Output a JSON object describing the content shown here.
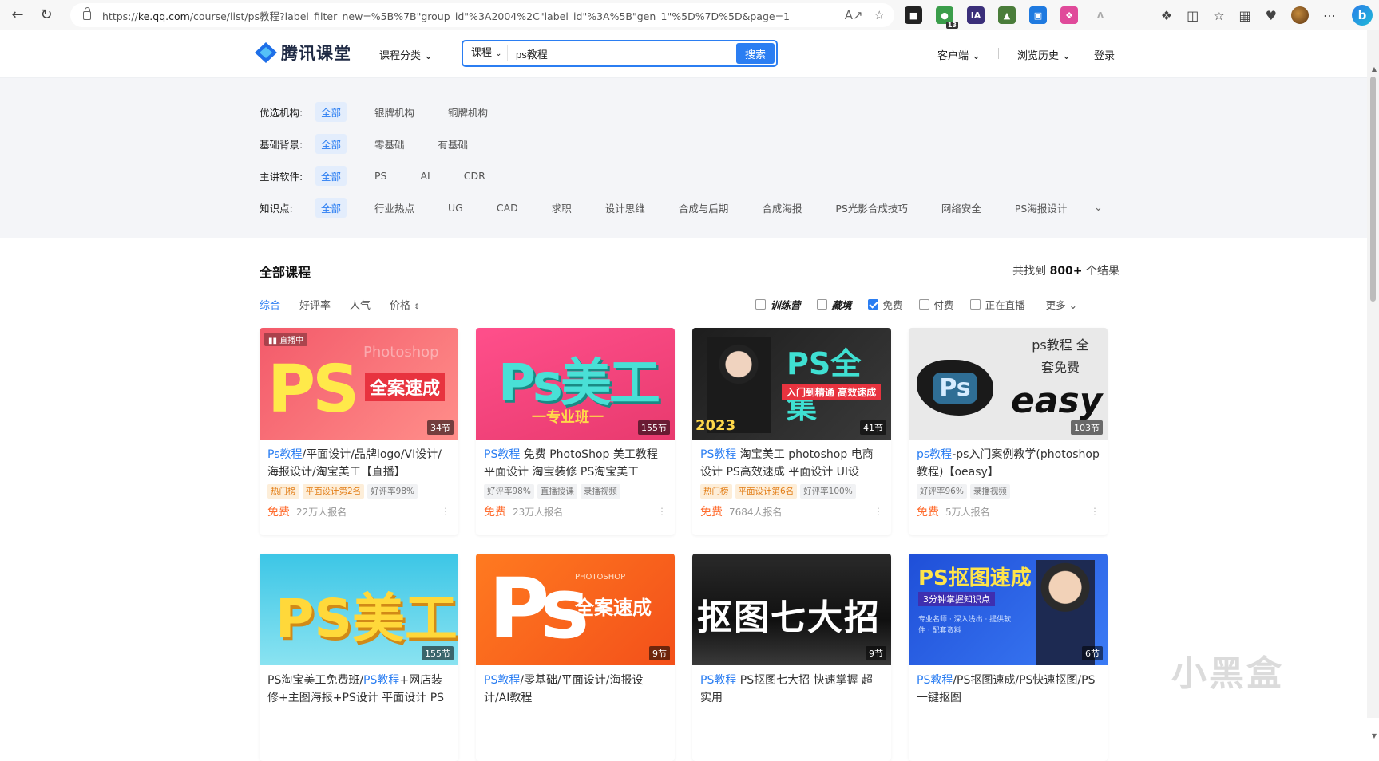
{
  "browser": {
    "url_prefix": "https://",
    "url_host": "ke.qq.com",
    "url_rest": "/course/list/ps教程?label_filter_new=%5B%7B\"group_id\"%3A2004%2C\"label_id\"%3A%5B\"gen_1\"%5D%7D%5D&page=1",
    "ext_badge": "13"
  },
  "header": {
    "logo_text": "腾讯课堂",
    "category_menu": "课程分类",
    "search_type": "课程",
    "search_value": "ps教程",
    "search_button": "搜索",
    "client": "客户端",
    "history": "浏览历史",
    "login": "登录"
  },
  "filters": {
    "institution": {
      "label": "优选机构:",
      "options": [
        "全部",
        "银牌机构",
        "铜牌机构"
      ]
    },
    "background": {
      "label": "基础背景:",
      "options": [
        "全部",
        "零基础",
        "有基础"
      ]
    },
    "software": {
      "label": "主讲软件:",
      "options": [
        "全部",
        "PS",
        "AI",
        "CDR"
      ]
    },
    "knowledge": {
      "label": "知识点:",
      "options": [
        "全部",
        "行业热点",
        "UG",
        "CAD",
        "求职",
        "设计思维",
        "合成与后期",
        "合成海报",
        "PS光影合成技巧",
        "网络安全",
        "PS海报设计"
      ]
    }
  },
  "list": {
    "title": "全部课程",
    "result_prefix": "共找到",
    "result_count": "800+",
    "result_suffix": "个结果",
    "sorts": [
      "综合",
      "好评率",
      "人气",
      "价格"
    ],
    "checks": [
      {
        "label": "训练营",
        "checked": false,
        "style": "badge"
      },
      {
        "label": "藏境",
        "checked": false,
        "style": "badge"
      },
      {
        "label": "免费",
        "checked": true,
        "style": "plain"
      },
      {
        "label": "付费",
        "checked": false,
        "style": "plain"
      },
      {
        "label": "正在直播",
        "checked": false,
        "style": "plain"
      }
    ],
    "more": "更多"
  },
  "courses": [
    {
      "keyword": "Ps教程",
      "title_rest": "/平面设计/品牌logo/VI设计/海报设计/淘宝美工【直播】",
      "lessons": "34节",
      "live": "直播中",
      "thumb_text": "PS",
      "thumb_sub": "全案速成",
      "thumb_en": "Photoshop",
      "tags": [
        {
          "t": "热门榜",
          "hot": true
        },
        {
          "t": "平面设计第2名",
          "hot": true
        },
        {
          "t": "好评率98%",
          "hot": false
        }
      ],
      "price": "免费",
      "enroll": "22万人报名"
    },
    {
      "keyword": "PS教程",
      "title_rest": " 免费 PhotoShop 美工教程 平面设计 淘宝装修 PS淘宝美工",
      "lessons": "155节",
      "live": "",
      "thumb_text": "Ps美工",
      "thumb_sub": "一专业班一",
      "thumb_en": "",
      "tags": [
        {
          "t": "好评率98%",
          "hot": false
        },
        {
          "t": "直播授课",
          "hot": false
        },
        {
          "t": "录播视频",
          "hot": false
        }
      ],
      "price": "免费",
      "enroll": "23万人报名"
    },
    {
      "keyword": "PS教程",
      "title_rest": " 淘宝美工 photoshop 电商设计 PS高效速成 平面设计 UI设",
      "lessons": "41节",
      "live": "",
      "thumb_text": "PS全集",
      "thumb_sub": "入门到精通 高效速成",
      "thumb_en": "2023",
      "tags": [
        {
          "t": "热门榜",
          "hot": true
        },
        {
          "t": "平面设计第6名",
          "hot": true
        },
        {
          "t": "好评率100%",
          "hot": false
        }
      ],
      "price": "免费",
      "enroll": "7684人报名"
    },
    {
      "keyword": "ps教程",
      "title_rest": "-ps入门案例教学(photoshop教程)【oeasy】",
      "lessons": "103节",
      "live": "",
      "thumb_text": "Ps",
      "thumb_sub": "easy",
      "thumb_en": "ps教程 全套免费",
      "tags": [
        {
          "t": "好评率96%",
          "hot": false
        },
        {
          "t": "录播视频",
          "hot": false
        }
      ],
      "price": "免费",
      "enroll": "5万人报名"
    },
    {
      "keyword": "",
      "title_pre": "PS淘宝美工免费班/",
      "title_kw2": "PS教程",
      "title_rest": "+网店装修+主图海报+PS设计 平面设计 PS",
      "lessons": "155节",
      "live": "",
      "thumb_text": "PS美工",
      "thumb_sub": "",
      "thumb_en": "",
      "tags": [],
      "price": "",
      "enroll": ""
    },
    {
      "keyword": "PS教程",
      "title_rest": "/零基础/平面设计/海报设计/AI教程",
      "lessons": "9节",
      "live": "",
      "thumb_text": "Ps",
      "thumb_sub": "全案速成",
      "thumb_en": "PHOTOSHOP",
      "tags": [],
      "price": "",
      "enroll": ""
    },
    {
      "keyword": "PS教程",
      "title_rest": " PS抠图七大招 快速掌握 超实用",
      "lessons": "9节",
      "live": "",
      "thumb_text": "抠图七大招",
      "thumb_sub": "",
      "thumb_en": "",
      "tags": [],
      "price": "",
      "enroll": ""
    },
    {
      "keyword": "PS教程",
      "title_rest": "/PS抠图速成/PS快速抠图/PS一键抠图",
      "lessons": "6节",
      "live": "",
      "thumb_text": "PS抠图速成",
      "thumb_sub": "3分钟掌握知识点",
      "thumb_en": "专业名师 · 深入浅出 · 提供软件 · 配套资料",
      "tags": [],
      "price": "",
      "enroll": ""
    }
  ],
  "watermark": "小黑盒",
  "colors": {
    "accent": "#2b7ef2",
    "price": "#ff6b2d",
    "hot_tag": "#e27c14"
  }
}
